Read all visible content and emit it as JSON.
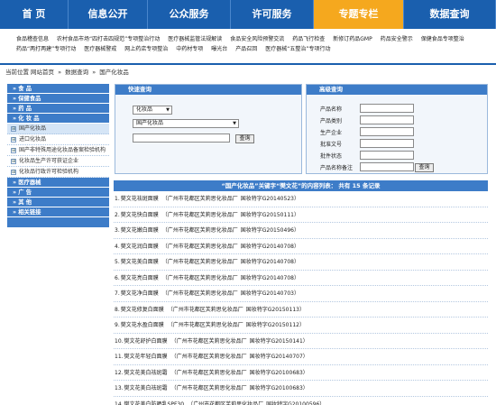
{
  "topnav": {
    "items": [
      {
        "label": "首  页"
      },
      {
        "label": "信息公开"
      },
      {
        "label": "公众服务"
      },
      {
        "label": "许可服务"
      },
      {
        "label": "专题专栏"
      },
      {
        "label": "数据查询"
      }
    ],
    "active_index": 4
  },
  "subnav": {
    "items": [
      "食品稽查信息",
      "农村食品市场“四打击四规范”专项整治行动",
      "医疗器械监管法规解读",
      "食品安全风险预警交流",
      "药品飞行检查",
      "新修订药品GMP",
      "药品安全警示",
      "保健食品专项整治",
      "药品“两打两建”专项行动",
      "医疗器械警戒",
      "网上药店专项整治",
      "中药材专项",
      "曝光台",
      "产品召回",
      "医疗器械“五整治”专项行动"
    ]
  },
  "breadcrumb": {
    "label": "当前位置",
    "items": [
      "网站首页",
      "数据查询",
      "国产化妆品"
    ],
    "separator": "»"
  },
  "sidebar": {
    "items": [
      {
        "label": "» 食    品",
        "type": "cat"
      },
      {
        "label": "» 保健食品",
        "type": "cat"
      },
      {
        "label": "» 药    品",
        "type": "cat"
      },
      {
        "label": "» 化 妆 品",
        "type": "cat"
      },
      {
        "label": "国产化妆品",
        "type": "sub",
        "current": true
      },
      {
        "label": "进口化妆品",
        "type": "sub"
      },
      {
        "label": "国产非特殊用途化妆品备案检验机构",
        "type": "sub"
      },
      {
        "label": "化妆品生产许可获证企业",
        "type": "sub"
      },
      {
        "label": "化妆品行政许可检验机构",
        "type": "sub"
      },
      {
        "label": "» 医疗器械",
        "type": "cat"
      },
      {
        "label": "» 广    告",
        "type": "cat"
      },
      {
        "label": "» 其    他",
        "type": "cat"
      },
      {
        "label": "» 相关链接",
        "type": "cat"
      }
    ],
    "box_glyph": "⊞"
  },
  "quick_search": {
    "title": "快速查询",
    "category_value": "化妆品",
    "subcategory_value": "国产化妆品",
    "keyword_value": "",
    "button": "查询",
    "select_arrow": "▼"
  },
  "advanced_search": {
    "title": "高级查询",
    "fields": [
      "产品名称",
      "产品类别",
      "生产企业",
      "批准文号",
      "批件状态",
      "产品名称备注"
    ],
    "button": "查询"
  },
  "results": {
    "header": "“国产化妆品”关键字“樊文花”的内容列表：  共有 15 条记录",
    "rows": [
      {
        "num": "1.",
        "name": "樊文花祛斑面膜",
        "company": "（广州市花都区芙莉思化妆品厂",
        "license": "国妆特字G20140523）"
      },
      {
        "num": "2.",
        "name": "樊文花快白面膜",
        "company": "（广州市花都区芙莉思化妆品厂",
        "license": "国妆特字G20150111）"
      },
      {
        "num": "3.",
        "name": "樊文花嫩白面膜",
        "company": "（广州市花都区芙莉思化妆品厂",
        "license": "国妆特字G20150496）"
      },
      {
        "num": "4.",
        "name": "樊文花润白面膜",
        "company": "（广州市花都区芙莉思化妆品厂",
        "license": "国妆特字G20140708）"
      },
      {
        "num": "5.",
        "name": "樊文花美白面膜",
        "company": "（广州市花都区芙莉思化妆品厂",
        "license": "国妆特字G20140708）"
      },
      {
        "num": "6.",
        "name": "樊文花亮白面膜",
        "company": "（广州市花都区芙莉思化妆品厂",
        "license": "国妆特字G20140708）"
      },
      {
        "num": "7.",
        "name": "樊文花净白面膜",
        "company": "（广州市花都区芙莉思化妆品厂",
        "license": "国妆特字G20140703）"
      },
      {
        "num": "8.",
        "name": "樊文花修复白面膜",
        "company": "（广州市花都区芙莉思化妆品厂",
        "license": "国妆特字G20150113）"
      },
      {
        "num": "9.",
        "name": "樊文花水盈白面膜",
        "company": "（广州市花都区芙莉思化妆品厂",
        "license": "国妆特字G20150112）"
      },
      {
        "num": "10.",
        "name": "樊文花舒护白面膜",
        "company": "（广州市花都区芙莉思化妆品厂",
        "license": "国妆特字G20150141）"
      },
      {
        "num": "11.",
        "name": "樊文花年轻白面膜",
        "company": "（广州市花都区芙莉思化妆品厂",
        "license": "国妆特字G20140707）"
      },
      {
        "num": "12.",
        "name": "樊文花美白祛斑霜",
        "company": "（广州市花都区芙莉思化妆品厂",
        "license": "国妆特字G20100683）"
      },
      {
        "num": "13.",
        "name": "樊文花美白祛斑霜",
        "company": "（广州市花都区芙莉思化妆品厂",
        "license": "国妆特字G20100683）"
      },
      {
        "num": "14.",
        "name": "樊文花美白防晒乳SPF30",
        "company": "（广州市花都区芙莉思化妆品厂",
        "license": "国妆特字G20100596）"
      }
    ]
  },
  "colors": {
    "nav_blue": "#1a5fae",
    "panel_blue": "#3d7cc8",
    "active_orange": "#f5a81e"
  }
}
